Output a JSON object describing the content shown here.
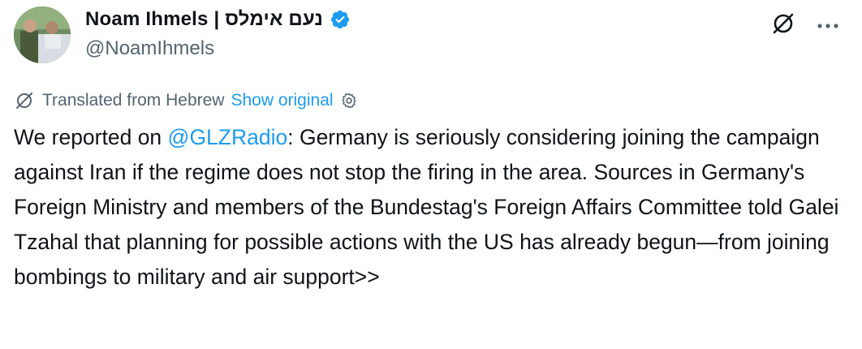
{
  "author": {
    "display_name": "Noam Ihmels | נעם אימלס",
    "handle": "@NoamIhmels",
    "verified": true
  },
  "icons": {
    "verified": "verified-badge-icon",
    "grok": "grok-icon",
    "more": "more-options-icon",
    "translate": "translate-icon",
    "settings": "gear-icon"
  },
  "translation": {
    "label": "Translated from Hebrew",
    "show_original": "Show original"
  },
  "tweet": {
    "text_before_mention": "We reported on ",
    "mention": "@GLZRadio",
    "text_after_mention": ": Germany is seriously considering joining the campaign against Iran if the regime does not stop the firing in the area. Sources in Germany's Foreign Ministry and members of the Bundestag's Foreign Affairs Committee told Galei Tzahal that planning for possible actions with the US has already begun—from joining bombings to military and air support>>"
  },
  "colors": {
    "accent": "#1d9bf0",
    "text": "#0f1419",
    "secondary": "#536471"
  }
}
